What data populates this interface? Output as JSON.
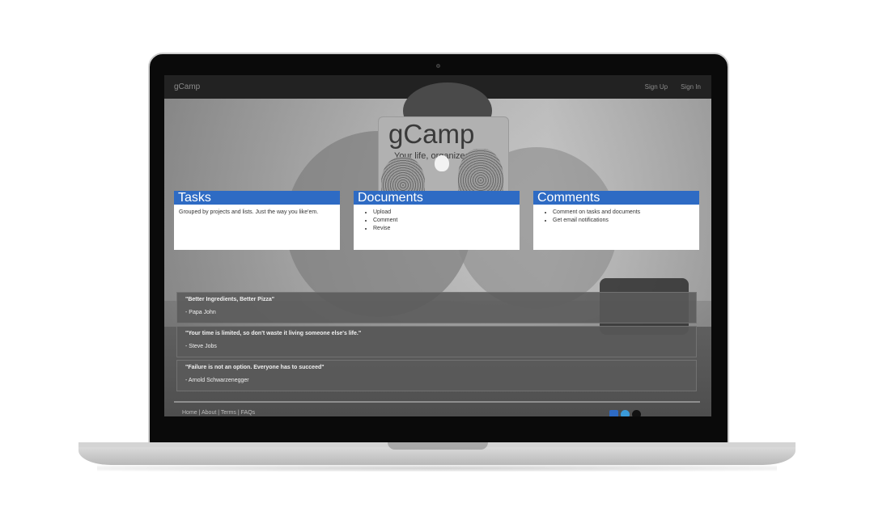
{
  "navbar": {
    "brand": "gCamp",
    "links": [
      "Sign Up",
      "Sign In"
    ]
  },
  "hero": {
    "photo_title": "gCamp",
    "photo_subtitle": "Your life, organized"
  },
  "features": [
    {
      "title": "Tasks",
      "text": "Grouped by projects and lists. Just the way you like'em."
    },
    {
      "title": "Documents",
      "items": [
        "Upload",
        "Comment",
        "Revise"
      ]
    },
    {
      "title": "Comments",
      "items": [
        "Comment on tasks and documents",
        "Get email notifications"
      ]
    }
  ],
  "quotes": [
    {
      "text": "\"Better Ingredients, Better Pizza\"",
      "author": "- Papa John"
    },
    {
      "text": "\"Your time is limited, so don't waste it living someone else's life.\"",
      "author": "- Steve Jobs"
    },
    {
      "text": "\"Failure is not an option. Everyone has to succeed\"",
      "author": "- Arnold Schwarzenegger"
    }
  ],
  "footer": {
    "links": "Home | About | Terms | FAQs"
  },
  "icons": {
    "social": [
      "linkedin-icon",
      "twitter-icon",
      "github-icon"
    ]
  },
  "colors": {
    "card_header": "#2e6bc4",
    "navbar": "#222222"
  }
}
